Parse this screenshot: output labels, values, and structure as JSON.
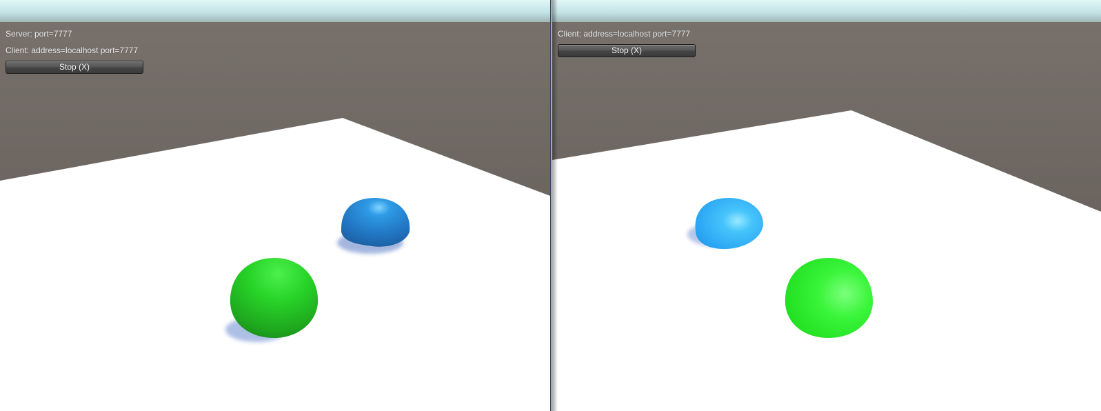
{
  "server_view": {
    "server_label": "Server: port=7777",
    "client_label": "Client: address=localhost port=7777",
    "stop_button": "Stop (X)",
    "objects": [
      {
        "name": "blue-player-sphere",
        "color": "#2a8fe0"
      },
      {
        "name": "green-player-sphere",
        "color": "#22cc22"
      }
    ]
  },
  "client_view": {
    "client_label": "Client: address=localhost port=7777",
    "stop_button": "Stop (X)",
    "objects": [
      {
        "name": "blue-player-sphere",
        "color": "#2ba7f5"
      },
      {
        "name": "green-player-sphere",
        "color": "#22e622"
      }
    ]
  },
  "colors": {
    "sky_top": "#d4f2f5",
    "sky_horizon": "#a3b5b5",
    "ground_far": "#716a65",
    "ground_near": "#5f5955",
    "plane": "#ffffff",
    "divider": "#2b3f58"
  }
}
